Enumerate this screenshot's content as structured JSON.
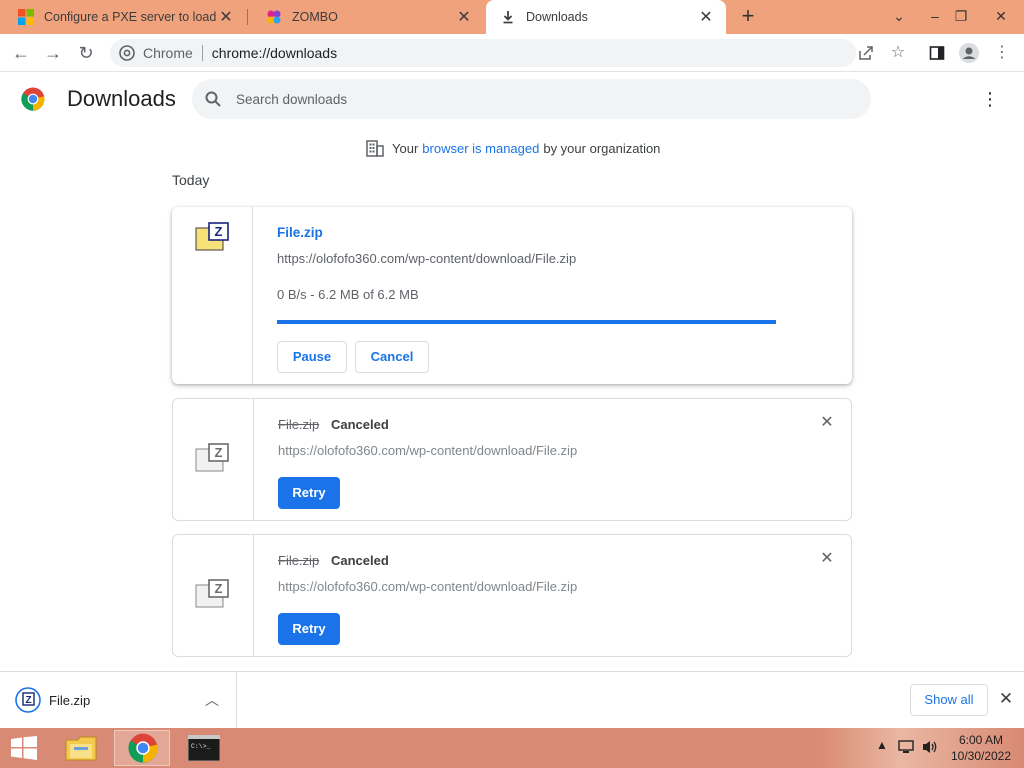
{
  "tabs": [
    {
      "title": "Configure a PXE server to load W",
      "favicon": "microsoft-logo-icon",
      "active": false
    },
    {
      "title": "ZOMBO",
      "favicon": "zombo-icon",
      "active": false
    },
    {
      "title": "Downloads",
      "favicon": "download-icon",
      "active": true
    }
  ],
  "toolbar": {
    "omnibox_site": "Chrome",
    "omnibox_url": "chrome://downloads"
  },
  "page": {
    "title": "Downloads",
    "search_placeholder": "Search downloads",
    "managed_prefix": "Your",
    "managed_link": "browser is managed",
    "managed_suffix": "by your organization",
    "section_label": "Today"
  },
  "downloads": [
    {
      "filename": "File.zip",
      "url": "https://olofofo360.com/wp-content/download/File.zip",
      "progress_text": "0 B/s - 6.2 MB of 6.2 MB",
      "progress_fraction": 1.0,
      "pause_label": "Pause",
      "cancel_label": "Cancel",
      "state": "in-progress"
    },
    {
      "filename": "File.zip",
      "status": "Canceled",
      "url": "https://olofofo360.com/wp-content/download/File.zip",
      "retry_label": "Retry",
      "state": "canceled"
    },
    {
      "filename": "File.zip",
      "status": "Canceled",
      "url": "https://olofofo360.com/wp-content/download/File.zip",
      "retry_label": "Retry",
      "state": "canceled"
    }
  ],
  "shelf": {
    "item_name": "File.zip",
    "show_all_label": "Show all"
  },
  "taskbar": {
    "time": "6:00 AM",
    "date": "10/30/2022"
  },
  "colors": {
    "accent": "#1a73e8",
    "tabstrip": "#f0a27d",
    "taskbar": "#d88a74"
  }
}
